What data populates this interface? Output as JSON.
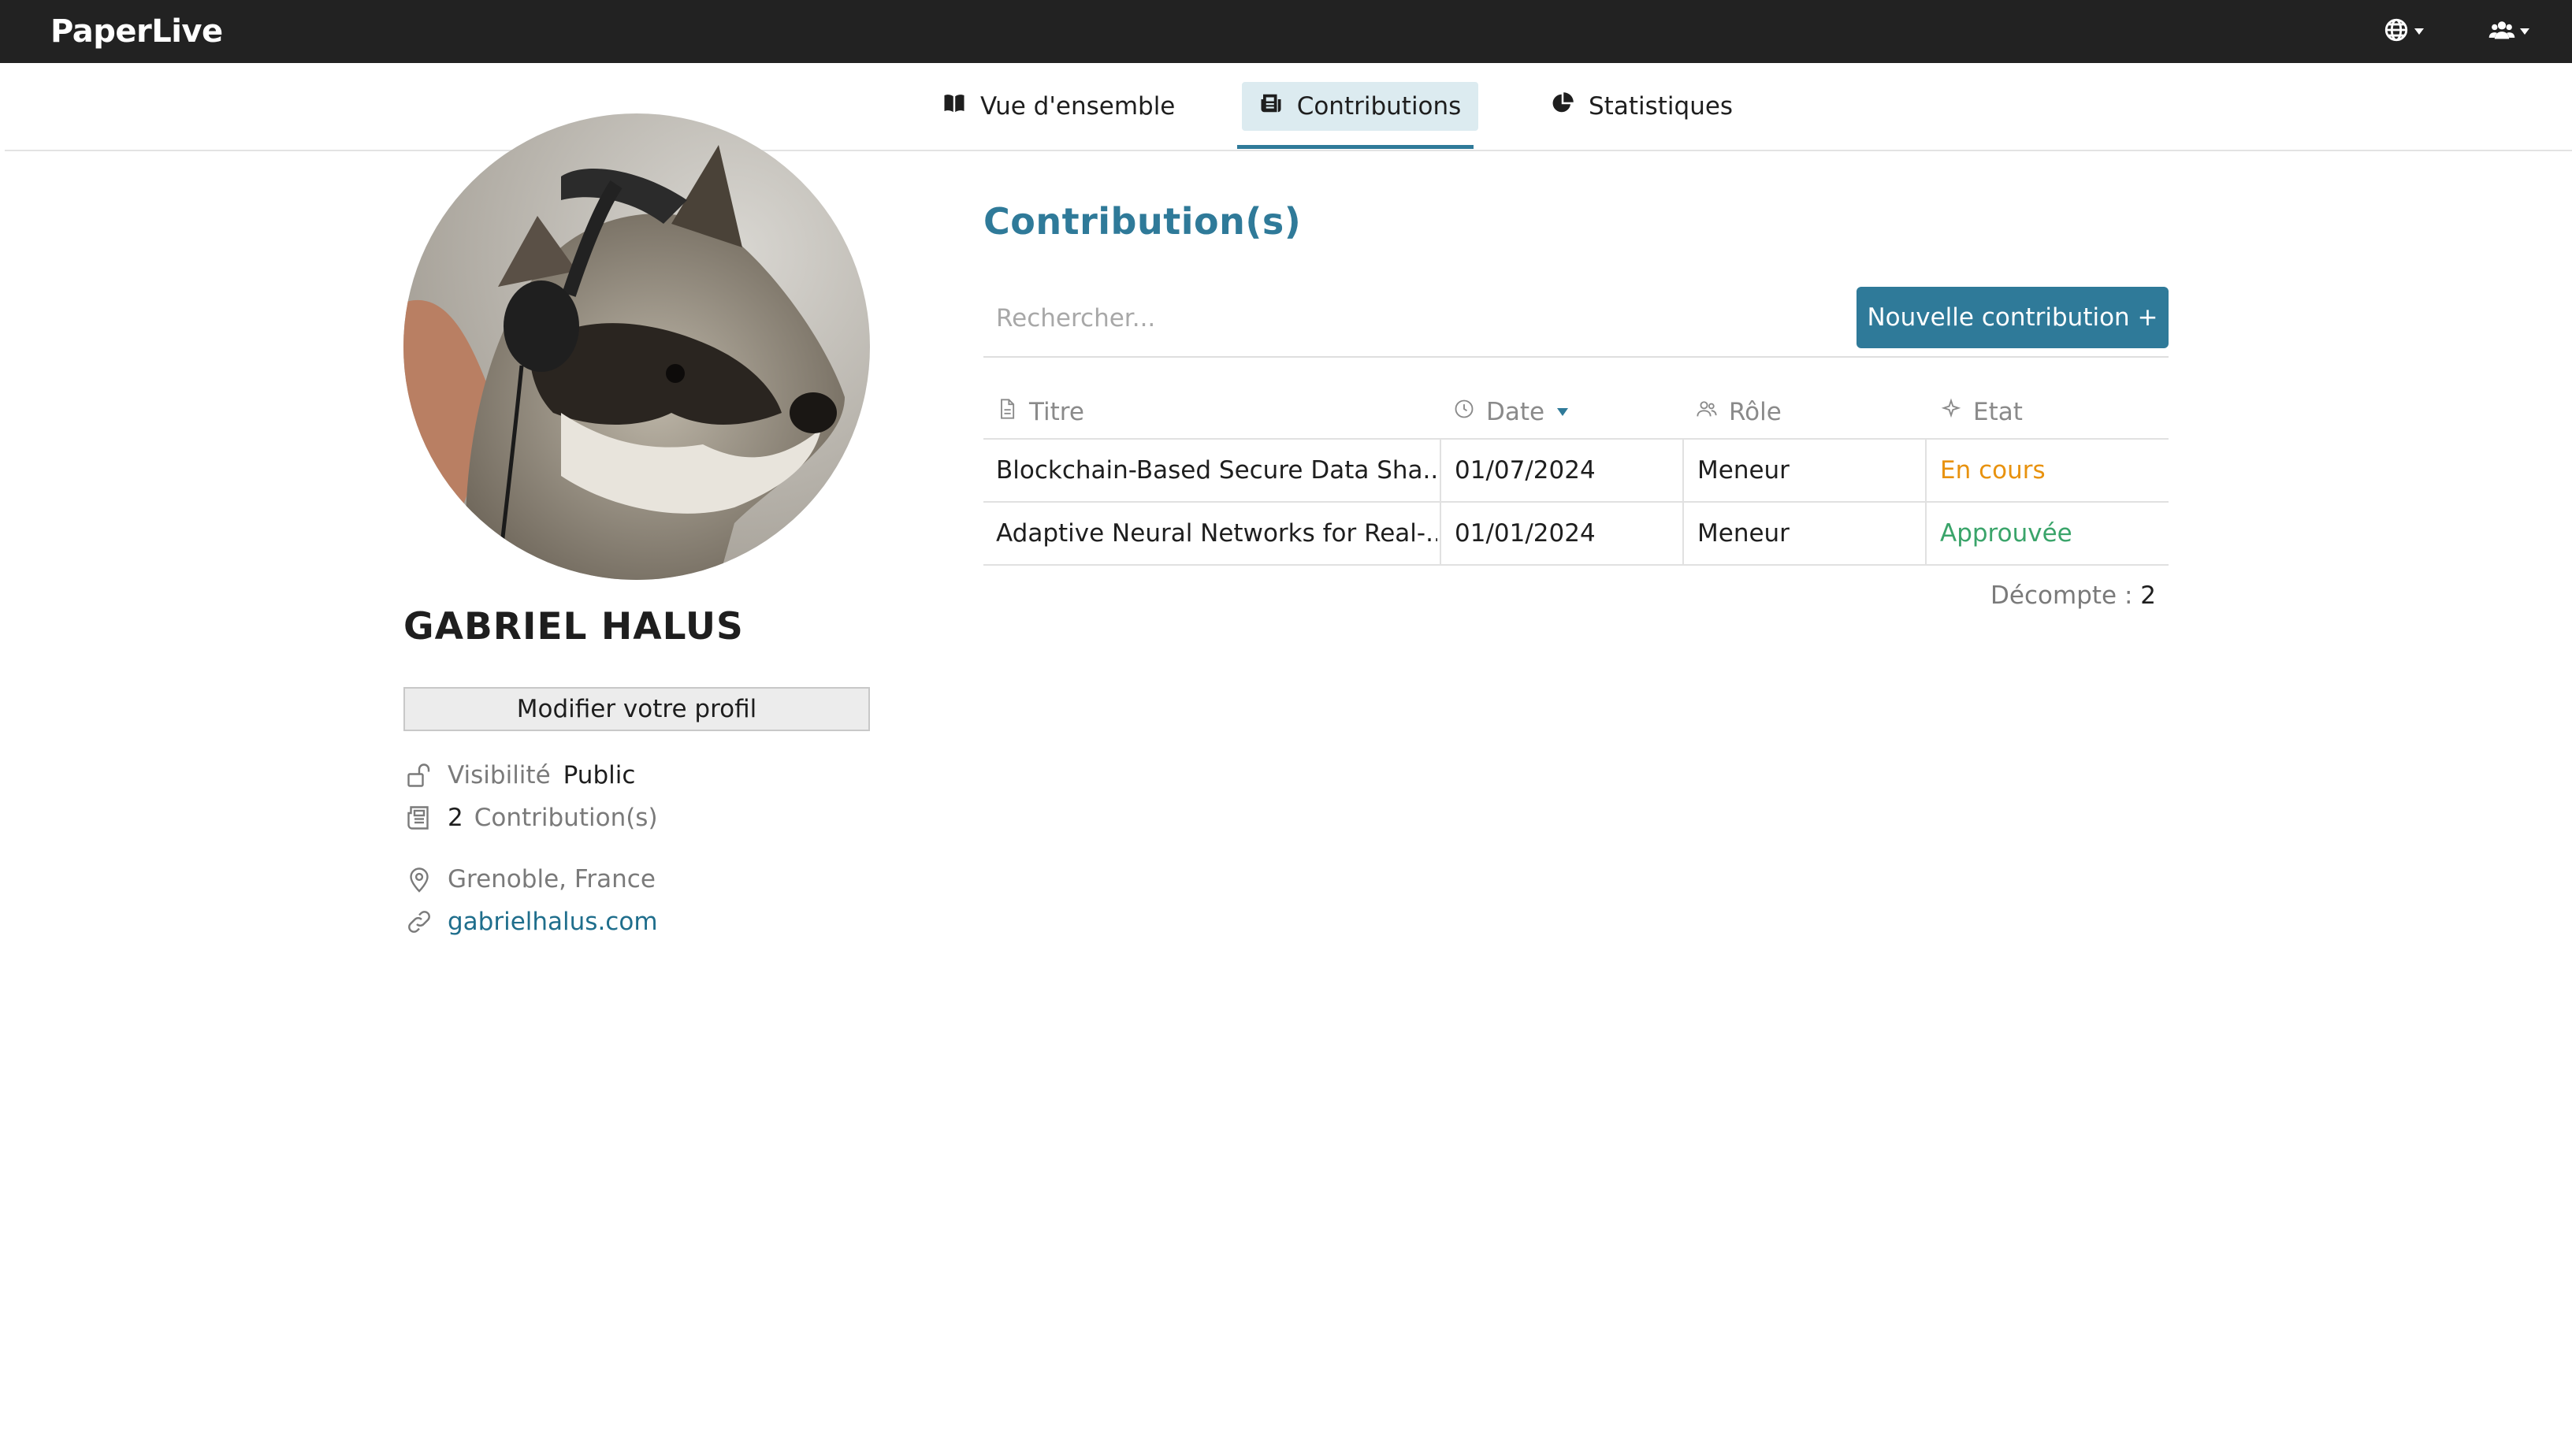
{
  "app": {
    "brand": "PaperLive"
  },
  "topbar": {
    "language_icon": "globe-icon",
    "users_icon": "users-icon"
  },
  "tabs": [
    {
      "label": "Vue d'ensemble",
      "icon": "book-open-icon",
      "active": false
    },
    {
      "label": "Contributions",
      "icon": "newspaper-icon",
      "active": true
    },
    {
      "label": "Statistiques",
      "icon": "pie-chart-icon",
      "active": false
    }
  ],
  "profile": {
    "name": "GABRIEL HALUS",
    "edit_button": "Modifier votre profil",
    "visibility_label": "Visibilité",
    "visibility_value": "Public",
    "contributions_count": "2",
    "contributions_label": "Contribution(s)",
    "location": "Grenoble, France",
    "website": "gabrielhalus.com"
  },
  "contributions": {
    "title": "Contribution(s)",
    "search_placeholder": "Rechercher...",
    "new_button": "Nouvelle contribution +",
    "columns": {
      "title": "Titre",
      "date": "Date",
      "role": "Rôle",
      "state": "Etat"
    },
    "rows": [
      {
        "title": "Blockchain-Based Secure Data Sha...",
        "date": "01/07/2024",
        "role": "Meneur",
        "state": "En cours"
      },
      {
        "title": "Adaptive Neural Networks for Real-...",
        "date": "01/01/2024",
        "role": "Meneur",
        "state": "Approuvée"
      }
    ],
    "count_label": "Décompte :",
    "count_value": "2"
  },
  "colors": {
    "accent": "#2f7a99",
    "status_in_progress": "#e8920e",
    "status_approved": "#3aa46a",
    "topbar": "#222222"
  }
}
